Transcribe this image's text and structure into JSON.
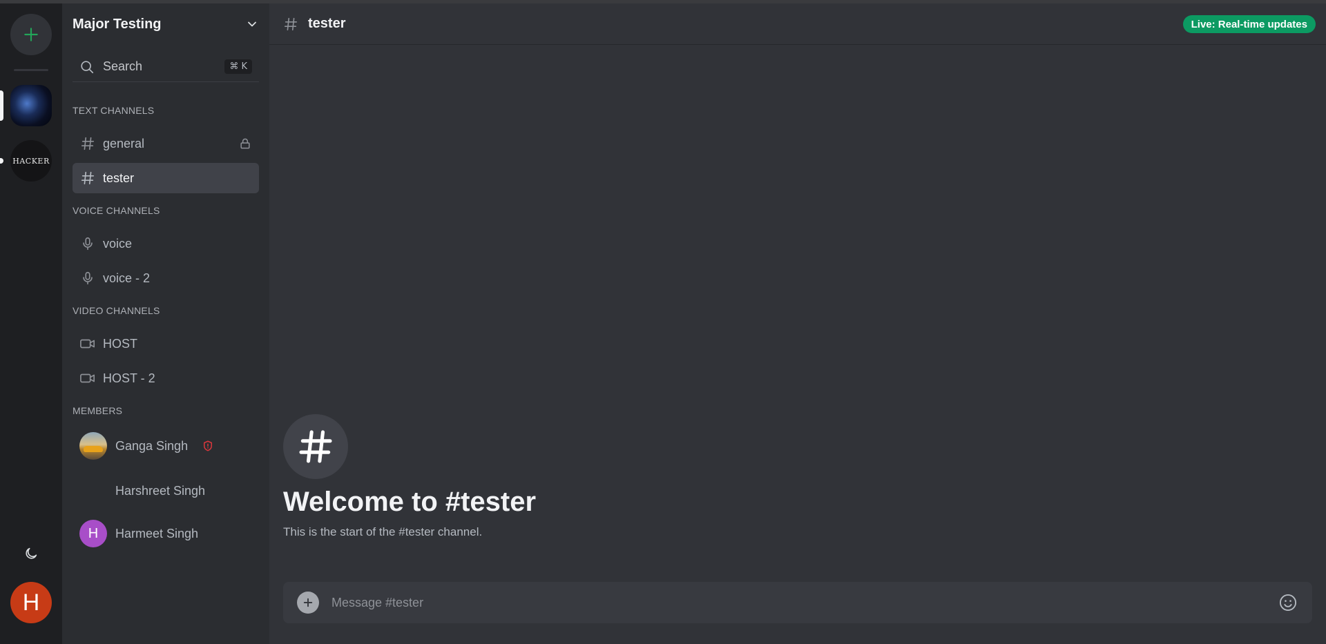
{
  "server": {
    "name": "Major Testing",
    "search_label": "Search",
    "search_shortcut": "⌘ K"
  },
  "sections": {
    "text": "TEXT CHANNELS",
    "voice": "VOICE CHANNELS",
    "video": "VIDEO CHANNELS",
    "members": "MEMBERS"
  },
  "text_channels": [
    {
      "name": "general",
      "icon": "hash-icon",
      "locked": true
    },
    {
      "name": "tester",
      "icon": "hash-icon",
      "active": true
    }
  ],
  "voice_channels": [
    {
      "name": "voice",
      "icon": "mic-icon"
    },
    {
      "name": "voice - 2",
      "icon": "mic-icon"
    }
  ],
  "video_channels": [
    {
      "name": "HOST",
      "icon": "video-icon"
    },
    {
      "name": "HOST - 2",
      "icon": "video-icon"
    }
  ],
  "members": [
    {
      "name": "Ganga Singh",
      "role_icon": "shield-alert-icon",
      "avatar": "photo"
    },
    {
      "name": "Harshreet Singh",
      "avatar": "none"
    },
    {
      "name": "Harmeet Singh",
      "avatar_initial": "H",
      "avatar_color": "#a84ec8"
    }
  ],
  "rail": {
    "servers": [
      {
        "name": "earth-server-icon"
      },
      {
        "name": "hacker-server-icon",
        "text": "HACKER"
      }
    ],
    "user_initial": "H",
    "user_color": "#c73b16"
  },
  "main": {
    "channel_title": "tester",
    "live_badge": "Live: Real-time updates",
    "welcome_title": "Welcome to #tester",
    "welcome_sub": "This is the start of the #tester channel.",
    "composer_placeholder": "Message #tester"
  },
  "colors": {
    "accent_green": "#23a559",
    "live_badge": "#0c9a62",
    "danger": "#da373c"
  }
}
